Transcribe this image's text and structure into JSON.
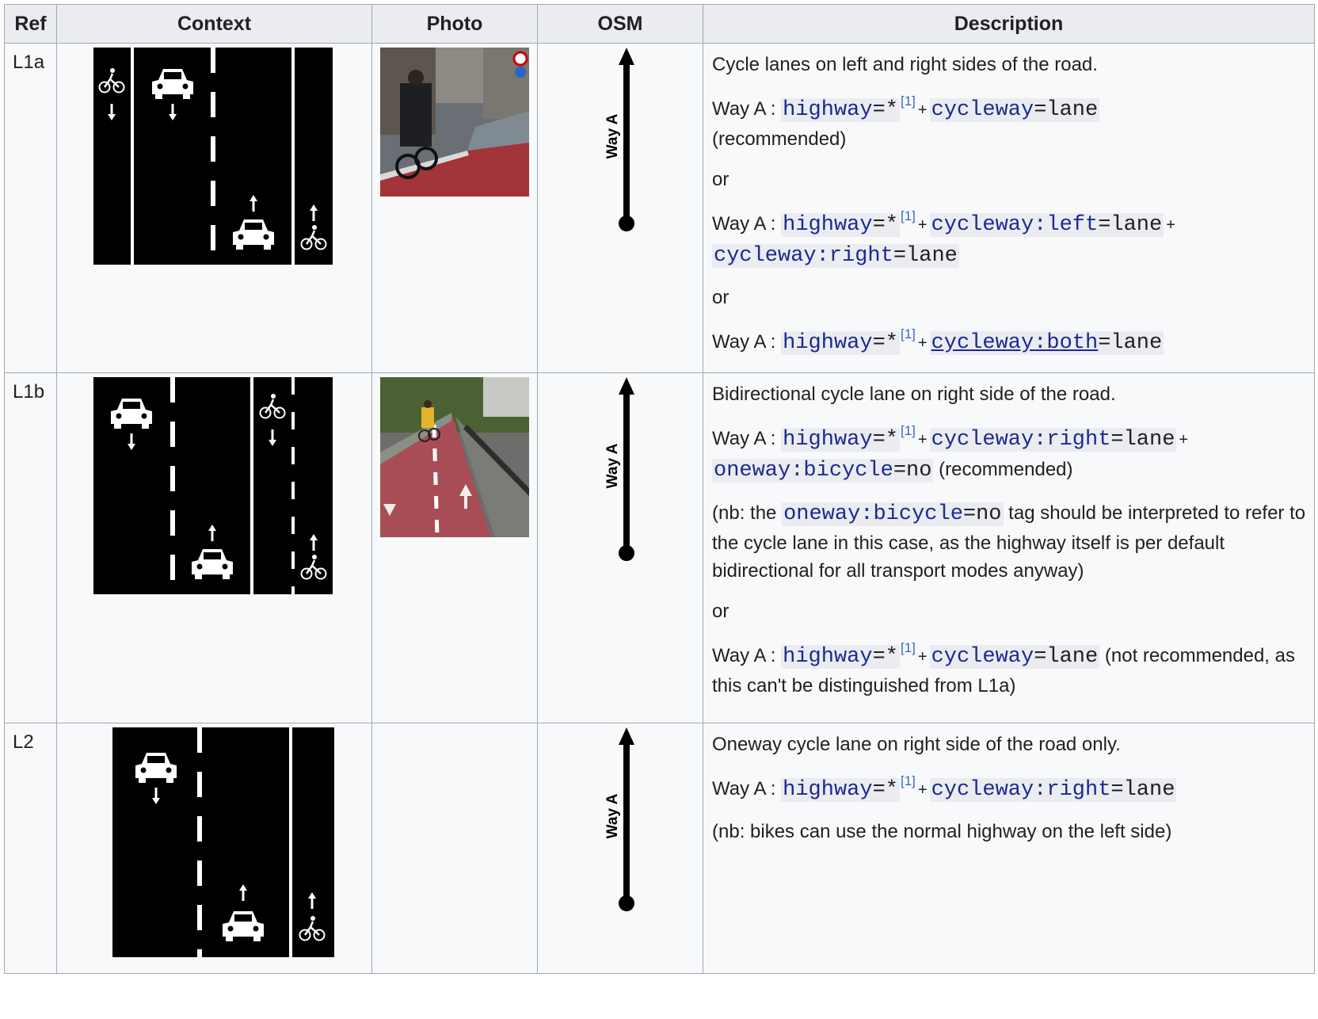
{
  "headers": {
    "ref": "Ref",
    "context": "Context",
    "photo": "Photo",
    "osm": "OSM",
    "description": "Description"
  },
  "way_label": "Way A",
  "rows": [
    {
      "ref": "L1a",
      "desc_lead": "Cycle lanes on left and right sides of the road.",
      "or_label": "or",
      "way_prefix": "Way A : ",
      "suffix_recommended": "(recommended)",
      "tags": {
        "highway_key": "highway",
        "highway_val": "*",
        "cycleway_key": "cycleway",
        "cycleway_val": "lane",
        "cycleway_left_key": "cycleway:left",
        "cycleway_right_key": "cycleway:right",
        "cycleway_both_key": "cycleway:both",
        "lane_val": "lane",
        "footnote": "[1]"
      }
    },
    {
      "ref": "L1b",
      "desc_lead": "Bidirectional cycle lane on right side of the road.",
      "or_label": "or",
      "way_prefix": "Way A : ",
      "suffix_recommended": "(recommended)",
      "nb_pre": "(nb: the ",
      "nb_post": " tag should be interpreted to refer to the cycle lane in this case, as the highway itself is per default bidirectional for all transport modes anyway)",
      "not_recommended": "(not recommended, as this can't be distinguished from L1a)",
      "tags": {
        "highway_key": "highway",
        "highway_val": "*",
        "cycleway_right_key": "cycleway:right",
        "lane_val": "lane",
        "oneway_bicycle_key": "oneway:bicycle",
        "no_val": "no",
        "cycleway_key": "cycleway",
        "footnote": "[1]"
      }
    },
    {
      "ref": "L2",
      "desc_lead": "Oneway cycle lane on right side of the road only.",
      "way_prefix": "Way A : ",
      "nb_text": "(nb: bikes can use the normal highway on the left side)",
      "tags": {
        "highway_key": "highway",
        "highway_val": "*",
        "cycleway_right_key": "cycleway:right",
        "lane_val": "lane",
        "footnote": "[1]"
      }
    }
  ]
}
